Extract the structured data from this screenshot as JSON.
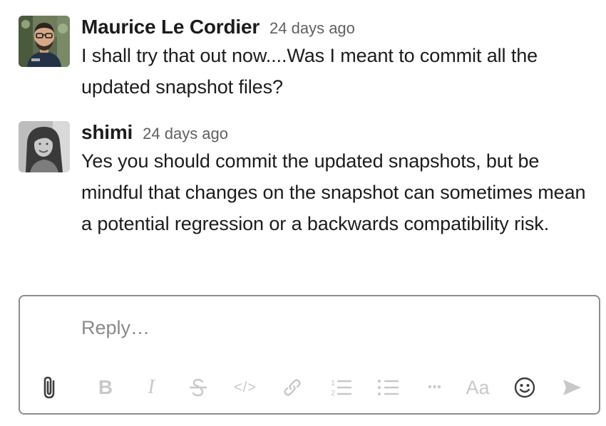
{
  "messages": [
    {
      "author": "Maurice Le Cordier",
      "timestamp": "24 days ago",
      "text": "I shall try that out now....Was I meant to commit all the updated snapshot files?",
      "avatar_icon": "man-with-glasses-photo"
    },
    {
      "author": "shimi",
      "timestamp": "24 days ago",
      "text": "Yes you should commit the updated snapshots, but be mindful that changes on the snapshot can sometimes mean a potential regression or a backwards compatibility risk.",
      "avatar_icon": "woman-smiling-photo"
    }
  ],
  "composer": {
    "placeholder": "Reply…",
    "value": "",
    "toolbar": {
      "attach_icon": "paperclip-icon",
      "bold_label": "B",
      "italic_label": "I",
      "strikethrough_icon": "strikethrough-icon",
      "code_label": "</>",
      "link_icon": "link-icon",
      "ordered_list_icon": "numbered-list-icon",
      "bullet_list_icon": "bulleted-list-icon",
      "more_label": "•••",
      "format_label": "Aa",
      "emoji_icon": "smiley-icon",
      "send_icon": "send-arrow-icon"
    }
  },
  "colors": {
    "text": "#1d1c1d",
    "timestamp": "#616061",
    "placeholder": "#8a8a8a",
    "disabled_icon": "#c8c8c8",
    "active_icon": "#3d3d3d",
    "border": "#8d8d8d"
  }
}
